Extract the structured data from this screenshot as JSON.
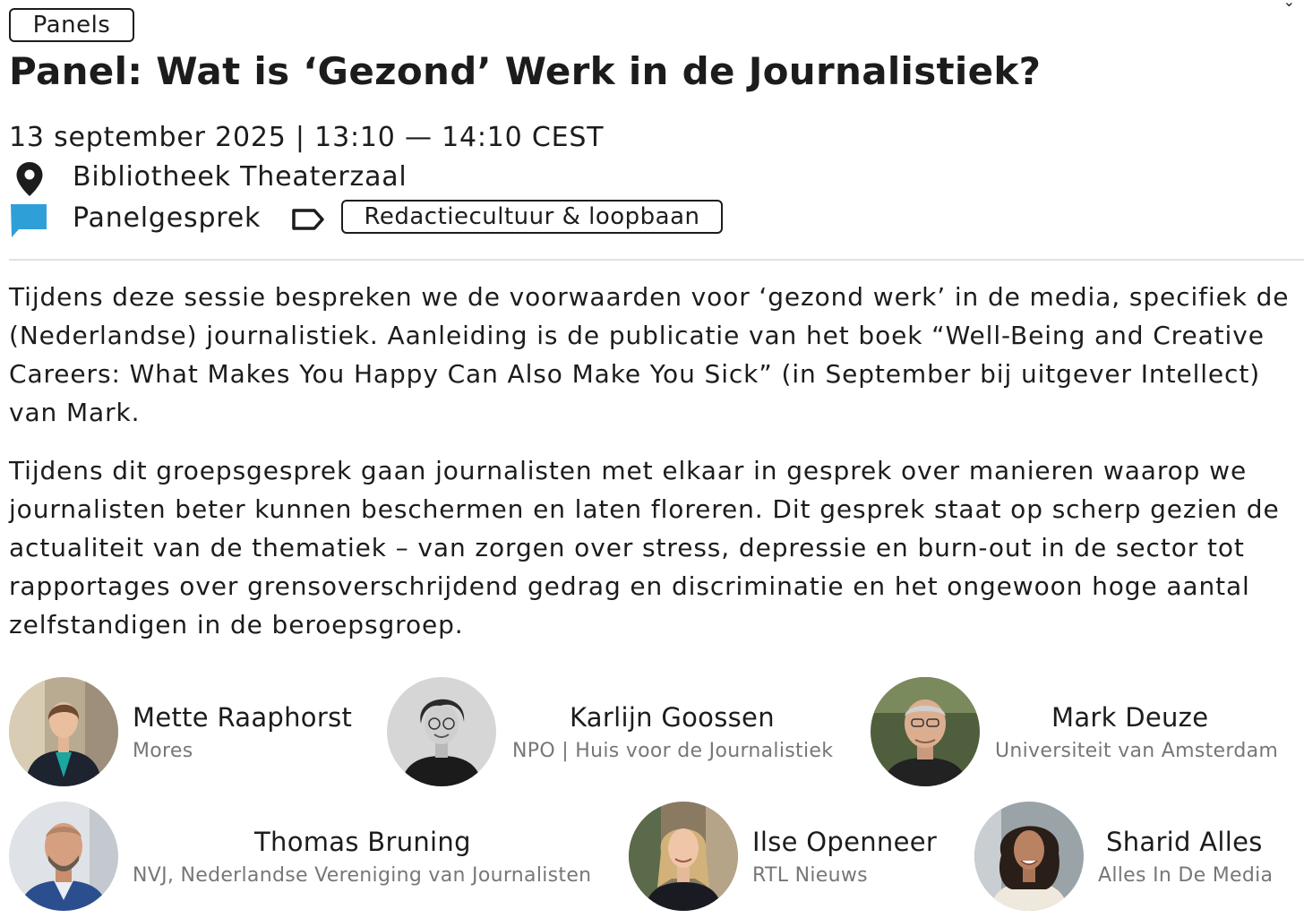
{
  "category_tag": "Panels",
  "title": "Panel: Wat is ‘Gezond’ Werk in de Journalistiek?",
  "datetime": "13 september 2025 | 13:10 — 14:10 CEST",
  "location": "Bibliotheek Theaterzaal",
  "session_type": "Panelgesprek",
  "topic_tag": "Redactiecultuur & loopbaan",
  "paragraphs": [
    "Tijdens deze sessie bespreken we de voorwaarden voor ‘gezond werk’ in de media, specifiek de (Nederlandse) journalistiek. Aanleiding is de publicatie van het boek “Well-Being and Creative Careers: What Makes You Happy Can Also Make You Sick” (in September bij uitgever Intellect) van Mark.",
    "Tijdens dit groepsgesprek gaan journalisten met elkaar in gesprek over manieren waarop we journalisten beter kunnen beschermen en laten floreren. Dit gesprek staat op scherp gezien de actualiteit van de thematiek – van zorgen over stress, depressie en burn-out in de sector tot rapportages over grensoverschrijdend gedrag en discriminatie en het ongewoon hoge aantal zelfstandigen in de beroepsgroep."
  ],
  "speakers": [
    {
      "name": "Mette Raaphorst",
      "org": "Mores"
    },
    {
      "name": "Karlijn Goossen",
      "org": "NPO | Huis voor de Journalistiek"
    },
    {
      "name": "Mark Deuze",
      "org": "Universiteit van Amsterdam"
    },
    {
      "name": "Thomas Bruning",
      "org": "NVJ, Nederlandse Vereniging van Journalisten"
    },
    {
      "name": "Ilse Openneer",
      "org": "RTL Nieuws"
    },
    {
      "name": "Sharid Alles",
      "org": "Alles In De Media"
    }
  ],
  "colors": {
    "text": "#1c1c1c",
    "muted": "#777777",
    "chat_icon": "#2f9fd8",
    "divider": "#e2e2e2"
  },
  "icons": {
    "location": "map-pin-icon",
    "session_type": "chat-bubble-icon",
    "topic": "tag-label-icon"
  }
}
